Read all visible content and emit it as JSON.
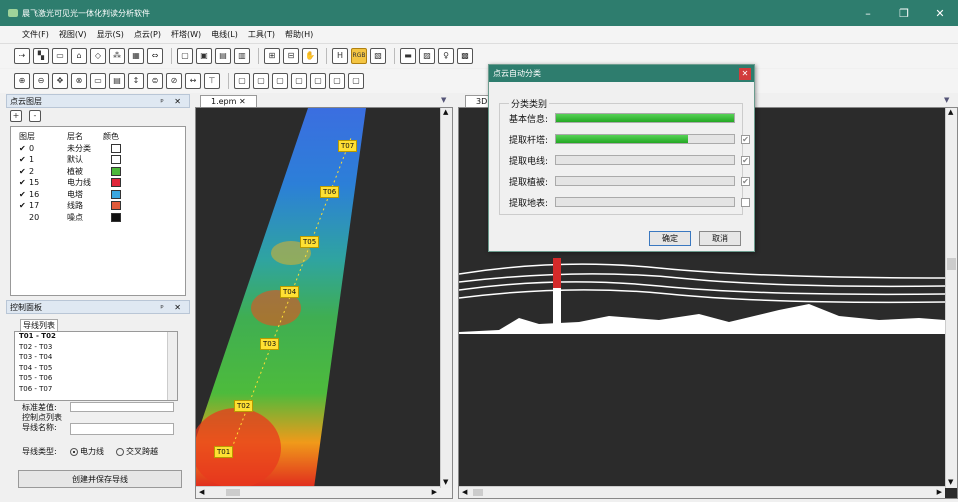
{
  "window": {
    "title": "晨飞激光可见光一体化判读分析软件",
    "controls": [
      "–",
      "❐",
      "✕"
    ]
  },
  "menu": [
    "文件(F)",
    "视图(V)",
    "显示(S)",
    "点云(P)",
    "杆塔(W)",
    "电线(L)",
    "工具(T)",
    "帮助(H)"
  ],
  "toolbar1": [
    "⇢",
    "▚",
    "▭",
    "⌂",
    "◇",
    "⁂",
    "▦",
    "⇔",
    "▢",
    "▣",
    "▤",
    "▥",
    "⊞",
    "⊟",
    "✋",
    "H",
    "RGB",
    "▧",
    "▬",
    "▨",
    "♀",
    "▩"
  ],
  "toolbar2": [
    "⊕",
    "⊖",
    "✥",
    "⊗",
    "▭",
    "▤",
    "↕",
    "⊜",
    "⊘",
    "↔",
    "⊤",
    "▢",
    "▢",
    "▢",
    "▢",
    "▢",
    "▢",
    "▢"
  ],
  "layer_panel": {
    "title": "点云图层",
    "controls": "ᵖ ✕",
    "add": "+",
    "remove": "-",
    "headers": [
      "图层",
      "层名",
      "颜色"
    ],
    "rows": [
      {
        "checked": "✔",
        "id": "0",
        "name": "未分类",
        "color": "#ffffff"
      },
      {
        "checked": "✔",
        "id": "1",
        "name": "默认",
        "color": "#ffffff"
      },
      {
        "checked": "✔",
        "id": "2",
        "name": "植被",
        "color": "#4cb83a"
      },
      {
        "checked": "✔",
        "id": "15",
        "name": "电力线",
        "color": "#e0263a"
      },
      {
        "checked": "✔",
        "id": "16",
        "name": "电塔",
        "color": "#3aa7e0"
      },
      {
        "checked": "✔",
        "id": "17",
        "name": "线路",
        "color": "#e05a3a"
      },
      {
        "checked": "",
        "id": "20",
        "name": "噪点",
        "color": "#111111"
      }
    ]
  },
  "control_panel": {
    "title": "控制面板",
    "controls": "ᵖ ✕",
    "list_label": "导线列表",
    "lines": [
      "T01 - T02",
      "T02 - T03",
      "T03 - T04",
      "T04 - T05",
      "T05 - T06",
      "T06 - T07"
    ],
    "std_value_label": "标准差值:",
    "ctrl_list_label": "控制点列表",
    "line_name_label": "导线名称:",
    "type_label": "导线类型:",
    "type_options": [
      "电力线",
      "交叉跨越"
    ],
    "create_button": "创建并保存导线"
  },
  "tabs": {
    "left": "1.epm",
    "left_close": "✕",
    "right": "3D"
  },
  "map": {
    "towers": [
      {
        "label": "T07"
      },
      {
        "label": "T06"
      },
      {
        "label": "T05"
      },
      {
        "label": "T04"
      },
      {
        "label": "T03"
      },
      {
        "label": "T02"
      },
      {
        "label": "T01"
      }
    ]
  },
  "scroll": {
    "up": "▲",
    "down": "▼",
    "left": "◀",
    "right": "▶"
  },
  "dialog": {
    "title": "点云自动分类",
    "close": "✕",
    "group_label": "分类类别",
    "rows": [
      {
        "label": "基本信息:",
        "progress": 1.0,
        "check": ""
      },
      {
        "label": "提取杆塔:",
        "progress": 0.74,
        "check": "✔"
      },
      {
        "label": "提取电线:",
        "progress": 0.0,
        "check": "✔"
      },
      {
        "label": "提取植被:",
        "progress": 0.0,
        "check": "✔"
      },
      {
        "label": "提取地表:",
        "progress": 0.0,
        "check": ""
      }
    ],
    "ok": "确定",
    "cancel": "取消"
  }
}
